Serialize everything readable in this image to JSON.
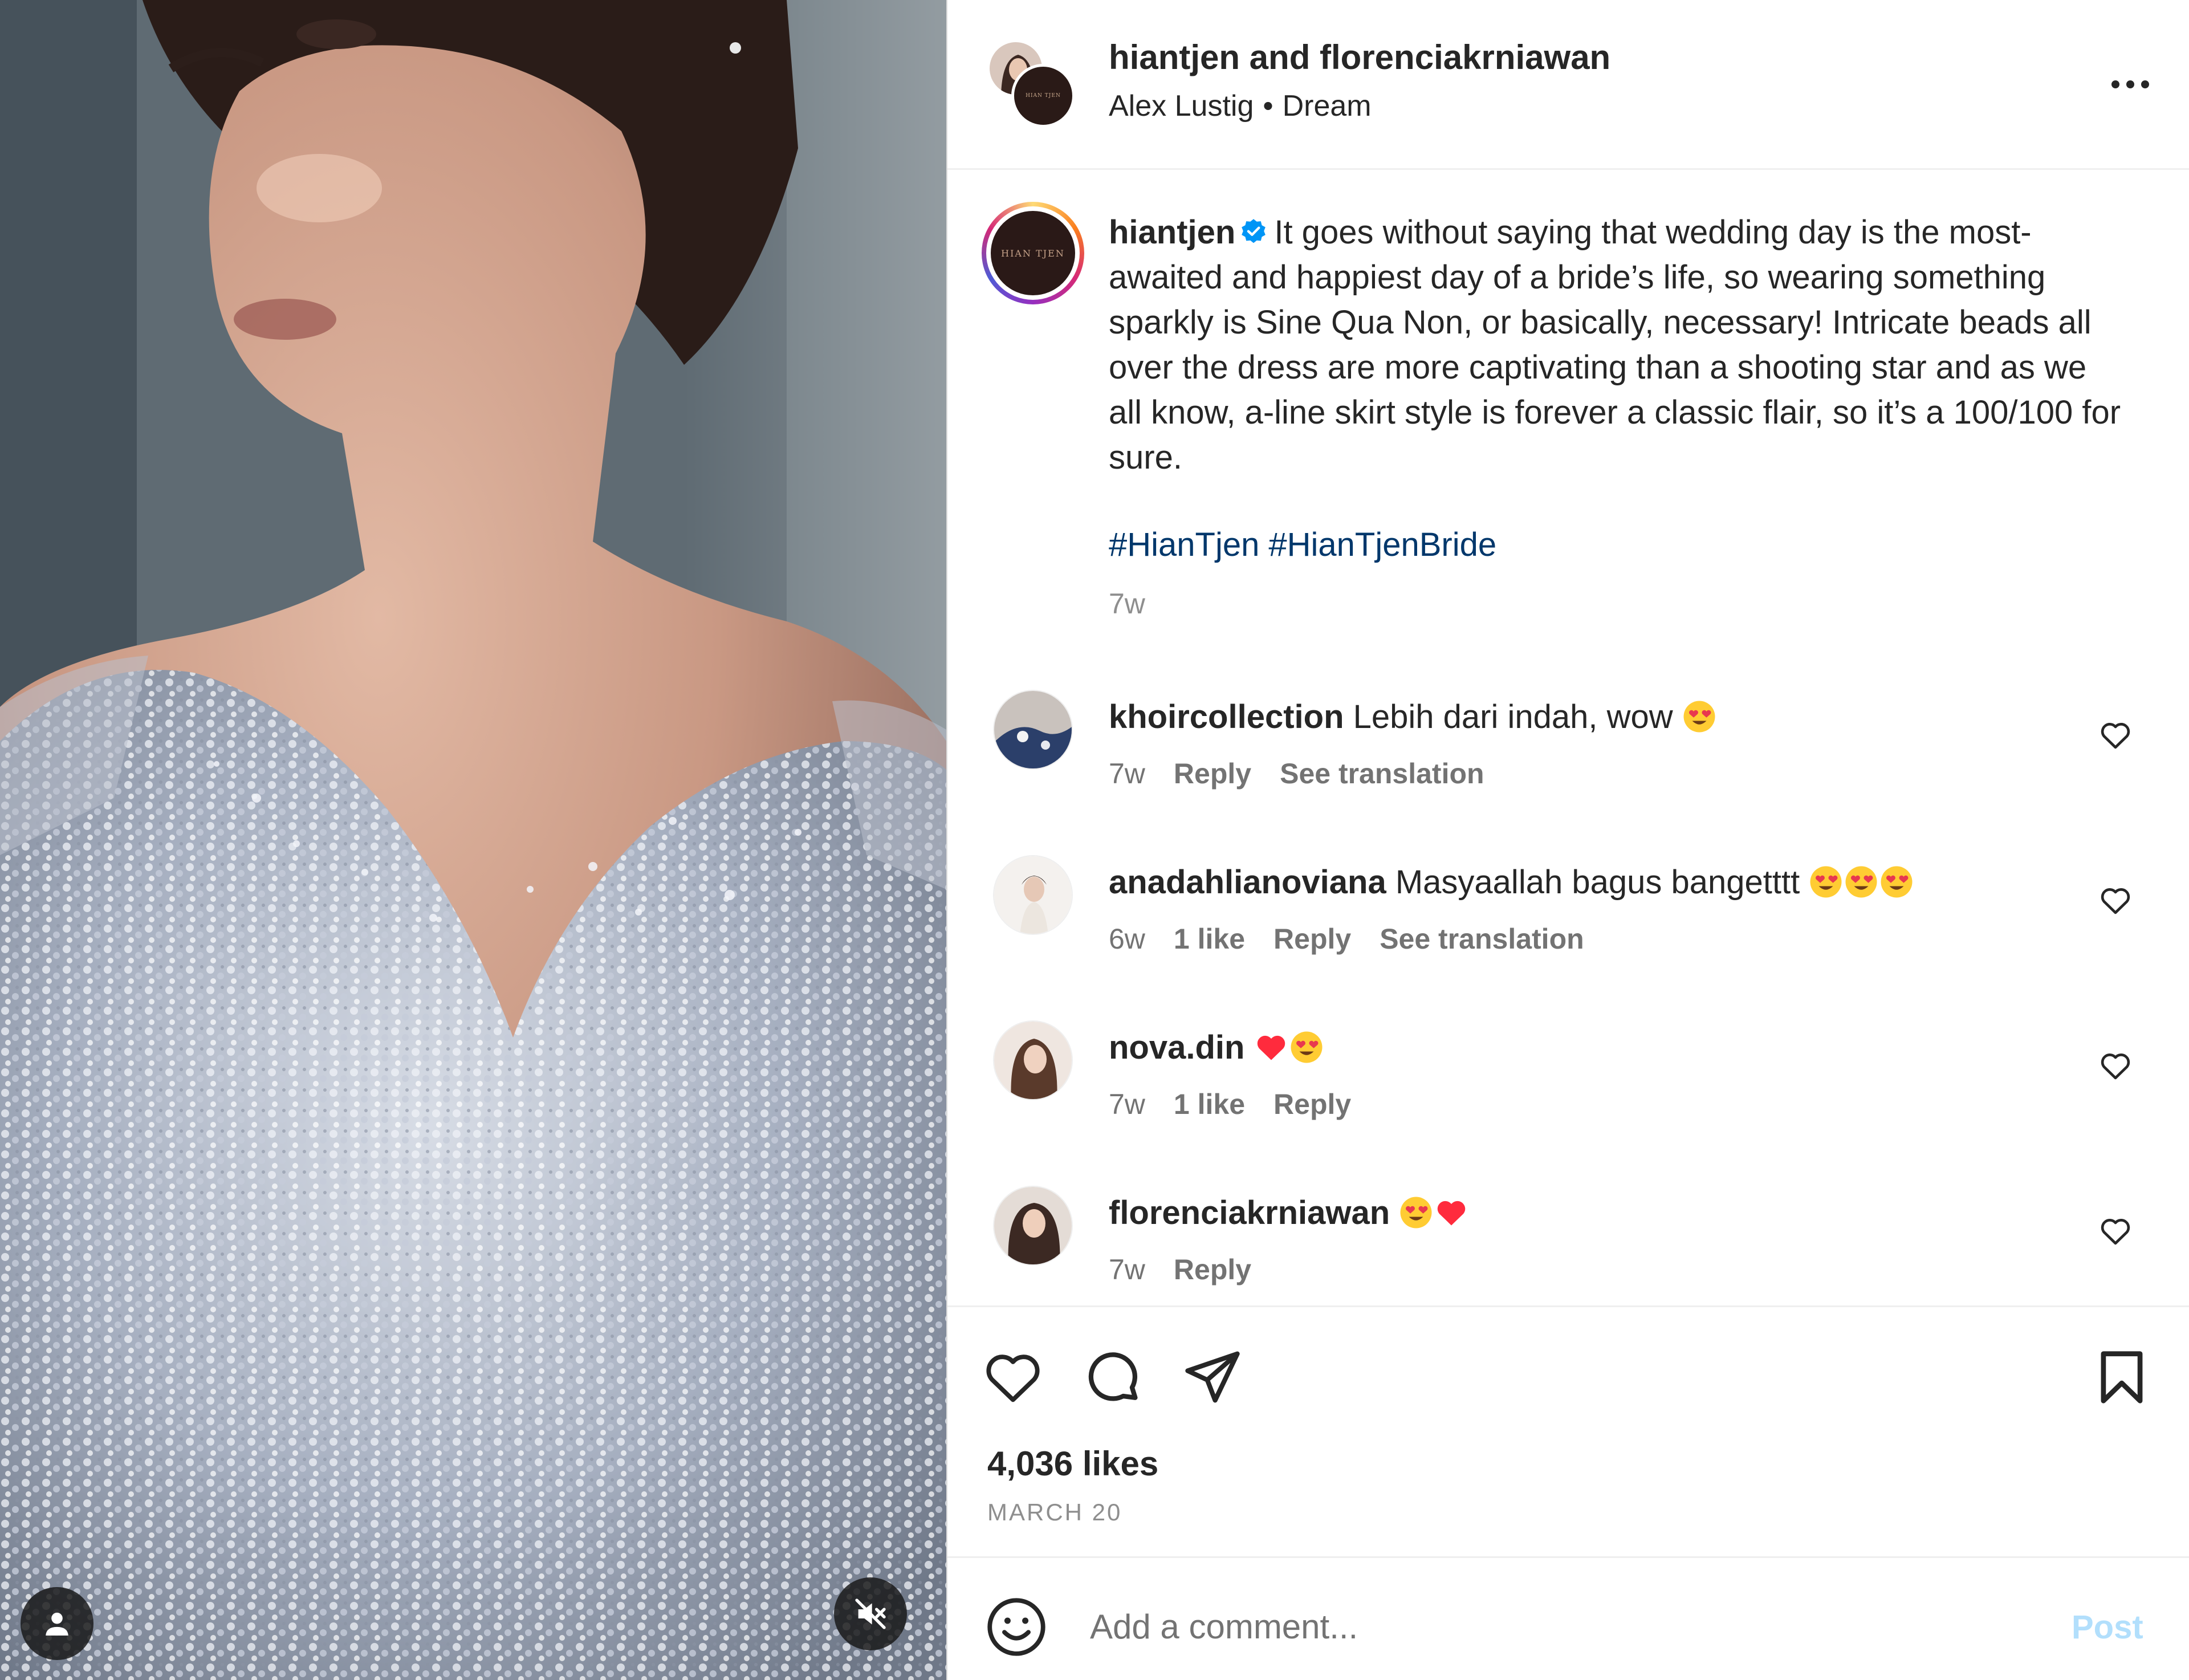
{
  "header": {
    "title_user1": "hiantjen",
    "title_and": " and ",
    "title_user2": "florenciakrniawan",
    "music_artist": "Alex Lustig",
    "separator": "•",
    "music_track": "Dream",
    "more_icon": "more-horizontal-icon",
    "brand_avatar_text": "HIAN TJEN"
  },
  "caption": {
    "username": "hiantjen",
    "verified_icon": "verified-badge-icon",
    "text": "It goes without saying that wedding day is the most-awaited and happiest day of a bride’s life, so wearing something sparkly is Sine Qua Non, or basically, necessary! Intricate beads all over the dress are more captivating than a shooting star and as we all know, a-line skirt style is forever a classic flair, so it’s a 100/100 for sure.",
    "hashtags": [
      "#HianTjen",
      "#HianTjenBride"
    ],
    "time": "7w",
    "brand_avatar_text": "HIAN TJEN"
  },
  "comments": [
    {
      "username": "khoircollection",
      "text": "Lebih dari indah, wow",
      "time": "7w",
      "likes": "",
      "reply": "Reply",
      "translation": "See translation"
    },
    {
      "username": "anadahlianoviana",
      "text": "Masyaallah bagus bangetttt",
      "time": "6w",
      "likes": "1 like",
      "reply": "Reply",
      "translation": "See translation"
    },
    {
      "username": "nova.din",
      "text": "",
      "time": "7w",
      "likes": "1 like",
      "reply": "Reply",
      "translation": ""
    },
    {
      "username": "florenciakrniawan",
      "text": "",
      "time": "7w",
      "likes": "",
      "reply": "Reply",
      "translation": ""
    }
  ],
  "actions": {
    "like_icon": "heart-icon",
    "comment_icon": "comment-bubble-icon",
    "share_icon": "paper-plane-icon",
    "save_icon": "bookmark-icon",
    "likes": "4,036 likes",
    "date": "MARCH 20"
  },
  "add_comment": {
    "emoji_icon": "smiley-icon",
    "placeholder": "Add a comment...",
    "post_label": "Post"
  },
  "media": {
    "user_tag_icon": "user-tag-icon",
    "mute_icon": "muted-speaker-icon"
  },
  "colors": {
    "link": "#00376b",
    "secondary": "#8e8e8e",
    "post_disabled": "#b2dffc",
    "verified": "#0095f6",
    "heart_red": "#ff2b3d"
  }
}
